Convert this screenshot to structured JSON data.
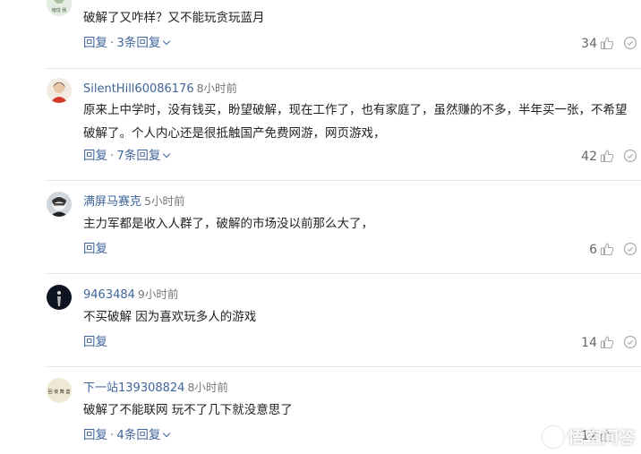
{
  "reply_label": "回复",
  "comments": [
    {
      "avatar_caption": "暗珑 我",
      "text": "破解了又咋样？又不能玩贪玩蓝月",
      "replies": "3条回复",
      "likes": "34"
    },
    {
      "user": "SilentHill60086176",
      "time": "8小时前",
      "text": "原来上中学时，没有钱买，盼望破解，现在工作了，也有家庭了，虽然赚的不多，半年买一张，不希望破解了。个人内心还是很抵触国产免费网游，网页游戏，",
      "replies": "7条回复",
      "likes": "42"
    },
    {
      "user": "满屏马赛克",
      "time": "5小时前",
      "text": "主力军都是收入人群了，破解的市场没以前那么大了，",
      "likes": "6"
    },
    {
      "user": "9463484",
      "time": "9小时前",
      "text": "不买破解 因为喜欢玩多人的游戏",
      "likes": "14"
    },
    {
      "user": "下一站139308824",
      "time": "8小时前",
      "avatar_caption": "回 夜 舞 盏",
      "text": "破解了不能联网 玩不了几下就没意思了",
      "replies": "4条回复",
      "likes": "12"
    }
  ],
  "watermark": "悟空问答",
  "colors": {
    "link": "#406599",
    "time": "#777777",
    "text": "#222222",
    "divider": "#e8e8e8"
  }
}
